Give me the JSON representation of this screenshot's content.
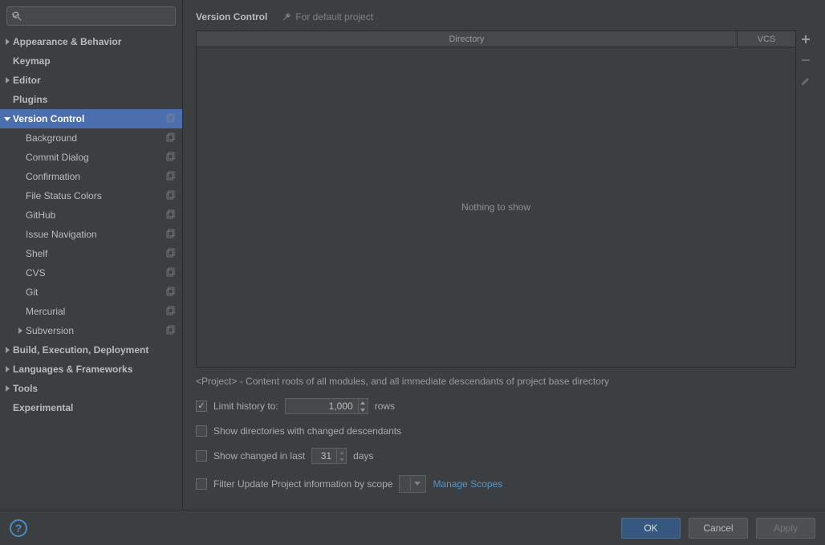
{
  "search": {
    "placeholder": ""
  },
  "sidebar": {
    "items": [
      {
        "label": "Appearance & Behavior",
        "indent": 0,
        "bold": true,
        "arrow": "right",
        "copy": false,
        "selected": false
      },
      {
        "label": "Keymap",
        "indent": 0,
        "bold": true,
        "arrow": "",
        "copy": false,
        "selected": false
      },
      {
        "label": "Editor",
        "indent": 0,
        "bold": true,
        "arrow": "right",
        "copy": false,
        "selected": false
      },
      {
        "label": "Plugins",
        "indent": 0,
        "bold": true,
        "arrow": "",
        "copy": false,
        "selected": false
      },
      {
        "label": "Version Control",
        "indent": 0,
        "bold": true,
        "arrow": "down",
        "copy": true,
        "selected": true
      },
      {
        "label": "Background",
        "indent": 1,
        "bold": false,
        "arrow": "",
        "copy": true,
        "selected": false
      },
      {
        "label": "Commit Dialog",
        "indent": 1,
        "bold": false,
        "arrow": "",
        "copy": true,
        "selected": false
      },
      {
        "label": "Confirmation",
        "indent": 1,
        "bold": false,
        "arrow": "",
        "copy": true,
        "selected": false
      },
      {
        "label": "File Status Colors",
        "indent": 1,
        "bold": false,
        "arrow": "",
        "copy": true,
        "selected": false
      },
      {
        "label": "GitHub",
        "indent": 1,
        "bold": false,
        "arrow": "",
        "copy": true,
        "selected": false
      },
      {
        "label": "Issue Navigation",
        "indent": 1,
        "bold": false,
        "arrow": "",
        "copy": true,
        "selected": false
      },
      {
        "label": "Shelf",
        "indent": 1,
        "bold": false,
        "arrow": "",
        "copy": true,
        "selected": false
      },
      {
        "label": "CVS",
        "indent": 1,
        "bold": false,
        "arrow": "",
        "copy": true,
        "selected": false
      },
      {
        "label": "Git",
        "indent": 1,
        "bold": false,
        "arrow": "",
        "copy": true,
        "selected": false
      },
      {
        "label": "Mercurial",
        "indent": 1,
        "bold": false,
        "arrow": "",
        "copy": true,
        "selected": false
      },
      {
        "label": "Subversion",
        "indent": 1,
        "bold": false,
        "arrow": "right",
        "copy": true,
        "selected": false
      },
      {
        "label": "Build, Execution, Deployment",
        "indent": 0,
        "bold": true,
        "arrow": "right",
        "copy": false,
        "selected": false
      },
      {
        "label": "Languages & Frameworks",
        "indent": 0,
        "bold": true,
        "arrow": "right",
        "copy": false,
        "selected": false
      },
      {
        "label": "Tools",
        "indent": 0,
        "bold": true,
        "arrow": "right",
        "copy": false,
        "selected": false
      },
      {
        "label": "Experimental",
        "indent": 0,
        "bold": true,
        "arrow": "",
        "copy": false,
        "selected": false
      }
    ]
  },
  "header": {
    "title": "Version Control",
    "subtitle": "For default project"
  },
  "table": {
    "col_directory": "Directory",
    "col_vcs": "VCS",
    "empty_text": "Nothing to show"
  },
  "hint": "<Project> - Content roots of all modules, and all immediate descendants of project base directory",
  "options": {
    "limit_history_label": "Limit history to:",
    "limit_history_value": "1,000",
    "limit_history_suffix": "rows",
    "show_dir_label": "Show directories with changed descendants",
    "show_changed_prefix": "Show changed in last",
    "show_changed_value": "31",
    "show_changed_suffix": "days",
    "filter_scope_label": "Filter Update Project information by scope",
    "manage_scopes": "Manage Scopes"
  },
  "footer": {
    "ok": "OK",
    "cancel": "Cancel",
    "apply": "Apply"
  }
}
